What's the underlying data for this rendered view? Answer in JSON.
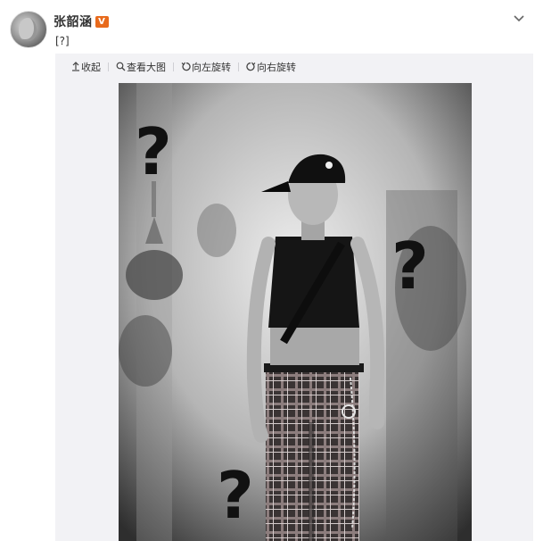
{
  "post": {
    "username": "张韶涵",
    "verified_badge": "V",
    "text": "[?]"
  },
  "toolbar": {
    "collapse_label": "收起",
    "view_large_label": "查看大图",
    "rotate_left_label": "向左旋转",
    "rotate_right_label": "向右旋转"
  },
  "icons": {
    "collapse": "collapse-up-icon",
    "view_large": "magnifier-icon",
    "rotate_left": "rotate-left-icon",
    "rotate_right": "rotate-right-icon",
    "expand": "chevron-down-icon"
  },
  "colors": {
    "badge": "#e86a1c",
    "panel_bg": "#f2f2f5",
    "text": "#333333"
  }
}
